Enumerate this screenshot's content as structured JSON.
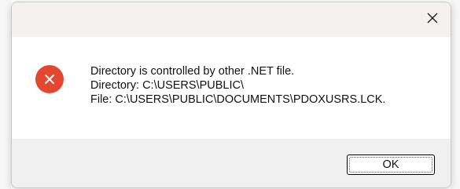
{
  "dialog": {
    "close_icon": "close-icon",
    "error_icon": "error-circle-x-icon",
    "accent_error": "#e4462f",
    "lines": [
      "Directory is controlled by other .NET file.",
      "Directory: C:\\USERS\\PUBLIC\\",
      "File: C:\\USERS\\PUBLIC\\DOCUMENTS\\PDOXUSRS.LCK."
    ],
    "ok_label": "OK"
  }
}
